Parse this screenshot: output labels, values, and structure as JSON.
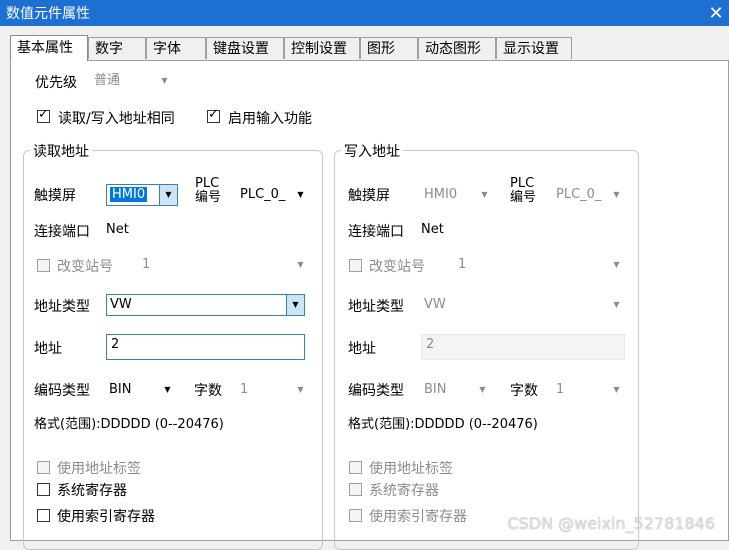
{
  "window": {
    "title": "数值元件属性"
  },
  "tabs": [
    "基本属性",
    "数字",
    "字体",
    "键盘设置",
    "控制设置",
    "图形",
    "动态图形",
    "显示设置"
  ],
  "priority": {
    "label": "优先级",
    "value": "普通"
  },
  "options": {
    "same_address": "读取/写入地址相同",
    "enable_input": "启用输入功能"
  },
  "read": {
    "legend": "读取地址",
    "touch_label": "触摸屏",
    "touch_value": "HMI0",
    "plc_label1": "PLC",
    "plc_label2": "编号",
    "plc_value": "PLC_0_",
    "port_label": "连接端口",
    "port_value": "Net",
    "change_station": "改变站号",
    "station_value": "1",
    "addr_type_label": "地址类型",
    "addr_type_value": "VW",
    "addr_label": "地址",
    "addr_value": "2",
    "code_type_label": "编码类型",
    "code_type_value": "BIN",
    "digits_label": "字数",
    "digits_value": "1",
    "format": "格式(范围):DDDDD (0--20476)",
    "use_tag": "使用地址标签",
    "sys_reg": "系统寄存器",
    "index_reg": "使用索引寄存器"
  },
  "write": {
    "legend": "写入地址",
    "touch_label": "触摸屏",
    "touch_value": "HMI0",
    "plc_label1": "PLC",
    "plc_label2": "编号",
    "plc_value": "PLC_0_",
    "port_label": "连接端口",
    "port_value": "Net",
    "change_station": "改变站号",
    "station_value": "1",
    "addr_type_label": "地址类型",
    "addr_type_value": "VW",
    "addr_label": "地址",
    "addr_value": "2",
    "code_type_label": "编码类型",
    "code_type_value": "BIN",
    "digits_label": "字数",
    "digits_value": "1",
    "format": "格式(范围):DDDDD (0--20476)",
    "use_tag": "使用地址标签",
    "sys_reg": "系统寄存器",
    "index_reg": "使用索引寄存器"
  },
  "watermark": "CSDN @weixin_52781846",
  "icons": {
    "close": "close-icon",
    "dropdown": "chevron-down-icon",
    "check": "checkmark-icon"
  }
}
